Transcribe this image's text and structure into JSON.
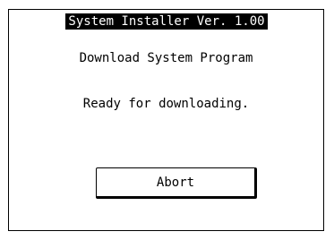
{
  "window": {
    "title": "System Installer  Ver. 1.00"
  },
  "main": {
    "heading": "Download System Program",
    "status": "Ready for downloading."
  },
  "actions": {
    "abort_label": "Abort"
  },
  "colors": {
    "background": "#ffffff",
    "foreground": "#000000"
  }
}
